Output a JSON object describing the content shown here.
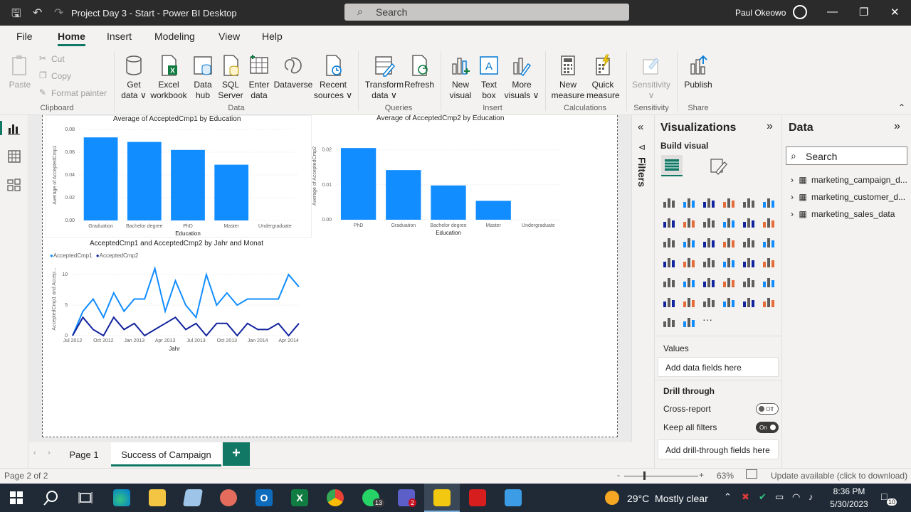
{
  "window": {
    "title": "Project Day 3 - Start - Power BI Desktop",
    "search_label": "Search",
    "user": "Paul Okeowo"
  },
  "menu": {
    "tabs": [
      {
        "label": "File"
      },
      {
        "label": "Home"
      },
      {
        "label": "Insert"
      },
      {
        "label": "Modeling"
      },
      {
        "label": "View"
      },
      {
        "label": "Help"
      }
    ]
  },
  "ribbon": {
    "clipboard": {
      "paste": "Paste",
      "cut": "Cut",
      "copy": "Copy",
      "format_painter": "Format painter",
      "group": "Clipboard"
    },
    "data": {
      "get_data": "Get data",
      "excel": "Excel workbook",
      "data_hub": "Data hub",
      "sql": "SQL Server",
      "enter_data": "Enter data",
      "dataverse": "Dataverse",
      "recent": "Recent sources",
      "group": "Data"
    },
    "queries": {
      "transform": "Transform data",
      "refresh": "Refresh",
      "group": "Queries"
    },
    "insert": {
      "new_visual": "New visual",
      "text_box": "Text box",
      "more_visuals": "More visuals",
      "group": "Insert"
    },
    "calculations": {
      "new_measure": "New measure",
      "quick_measure": "Quick measure",
      "group": "Calculations"
    },
    "sensitivity": {
      "label": "Sensitivity",
      "group": "Sensitivity"
    },
    "share": {
      "publish": "Publish",
      "group": "Share"
    }
  },
  "filters_label": "Filters",
  "visualizations": {
    "title": "Visualizations",
    "build_visual": "Build visual",
    "values_label": "Values",
    "values_placeholder": "Add data fields here",
    "drill_through": "Drill through",
    "cross_report": "Cross-report",
    "cross_report_state": "Off",
    "keep_filters": "Keep all filters",
    "keep_filters_state": "On",
    "drill_placeholder": "Add drill-through fields here",
    "more_label": "···"
  },
  "data_pane": {
    "title": "Data",
    "search_placeholder": "Search",
    "tables": [
      {
        "name": "marketing_campaign_d..."
      },
      {
        "name": "marketing_customer_d..."
      },
      {
        "name": "marketing_sales_data"
      }
    ]
  },
  "pages": {
    "tabs": [
      {
        "label": "Page 1"
      },
      {
        "label": "Success of Campaign"
      }
    ],
    "add": "+"
  },
  "status": {
    "page": "Page 2 of 2",
    "zoom": "63%",
    "update": "Update available (click to download)",
    "zoom_minus": "-",
    "zoom_plus": "+"
  },
  "taskbar": {
    "weather": "29°C  Mostly clear",
    "time": "8:36 PM",
    "date": "5/30/2023",
    "whatsapp_badge": "13",
    "teams_badge": "2",
    "notif_badge": "10"
  },
  "chart_data": [
    {
      "type": "bar",
      "title": "Average of AcceptedCmp1 by Education",
      "xlabel": "Education",
      "ylabel": "Average of AcceptedCmp1",
      "categories": [
        "Graduation",
        "Bachelor degree",
        "PhD",
        "Master",
        "Undergraduate"
      ],
      "values": [
        0.073,
        0.069,
        0.062,
        0.049,
        0
      ],
      "ylim": [
        0,
        0.08
      ],
      "yticks": [
        "0.00",
        "0.02",
        "0.04",
        "0.06",
        "0.08"
      ],
      "color": "#118dff"
    },
    {
      "type": "bar",
      "title": "Average of AcceptedCmp2 by Education",
      "xlabel": "Education",
      "ylabel": "Average of AcceptedCmp2",
      "categories": [
        "PhD",
        "Graduation",
        "Bachelor degree",
        "Master",
        "Undergraduate"
      ],
      "values": [
        0.0205,
        0.0142,
        0.0098,
        0.0054,
        0
      ],
      "ylim": [
        0,
        0.025
      ],
      "yticks": [
        "0.00",
        "0.01",
        "0.02"
      ],
      "color": "#118dff"
    },
    {
      "type": "line",
      "title": "AcceptedCmp1 and AcceptedCmp2 by Jahr and Monat",
      "xlabel": "Jahr",
      "ylabel": "AcceptedCmp1 and Accep...",
      "x_ticks": [
        "Jul 2012",
        "Oct 2012",
        "Jan 2013",
        "Apr 2013",
        "Jul 2013",
        "Oct 2013",
        "Jan 2014",
        "Apr 2014"
      ],
      "yticks": [
        "0",
        "5",
        "10"
      ],
      "ylim": [
        0,
        12
      ],
      "series": [
        {
          "name": "AcceptedCmp1",
          "color": "#118dff",
          "values": [
            0,
            4,
            6,
            3,
            7,
            4,
            6,
            6,
            11,
            4,
            9,
            5,
            3,
            10,
            5,
            7,
            5,
            6,
            6,
            6,
            6,
            10,
            8
          ]
        },
        {
          "name": "AcceptedCmp2",
          "color": "#12239e",
          "values": [
            0,
            3,
            1,
            0,
            3,
            1,
            2,
            0,
            1,
            2,
            3,
            1,
            2,
            0,
            2,
            2,
            0,
            2,
            1,
            1,
            2,
            0,
            2
          ]
        }
      ]
    }
  ]
}
